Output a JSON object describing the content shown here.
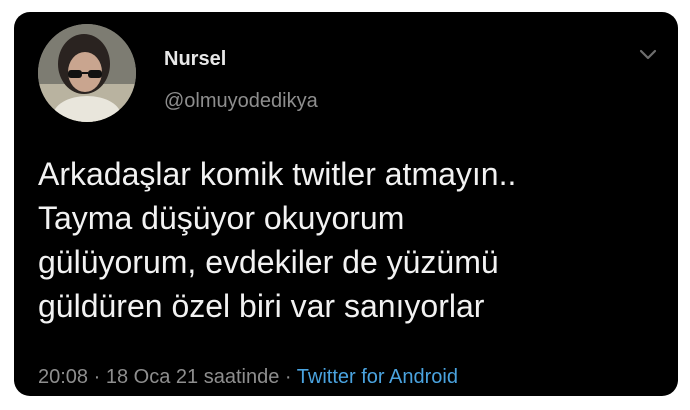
{
  "user": {
    "display_name": "Nursel",
    "handle": "@olmuyodedikya"
  },
  "tweet": {
    "lines": [
      "Arkadaşlar komik twitler atmayın..",
      "Tayma düşüyor okuyorum",
      "gülüyorum, evdekiler de yüzümü",
      "güldüren özel biri var sanıyorlar"
    ]
  },
  "meta": {
    "time": "20:08",
    "separator": "·",
    "date": "18 Oca 21 saatinde",
    "source": "Twitter for Android"
  },
  "icons": {
    "menu": "chevron-down-icon",
    "avatar": "avatar"
  },
  "colors": {
    "background": "#000000",
    "text": "#f2f2f2",
    "secondary": "#8e8e8e",
    "link": "#4aa3df"
  }
}
